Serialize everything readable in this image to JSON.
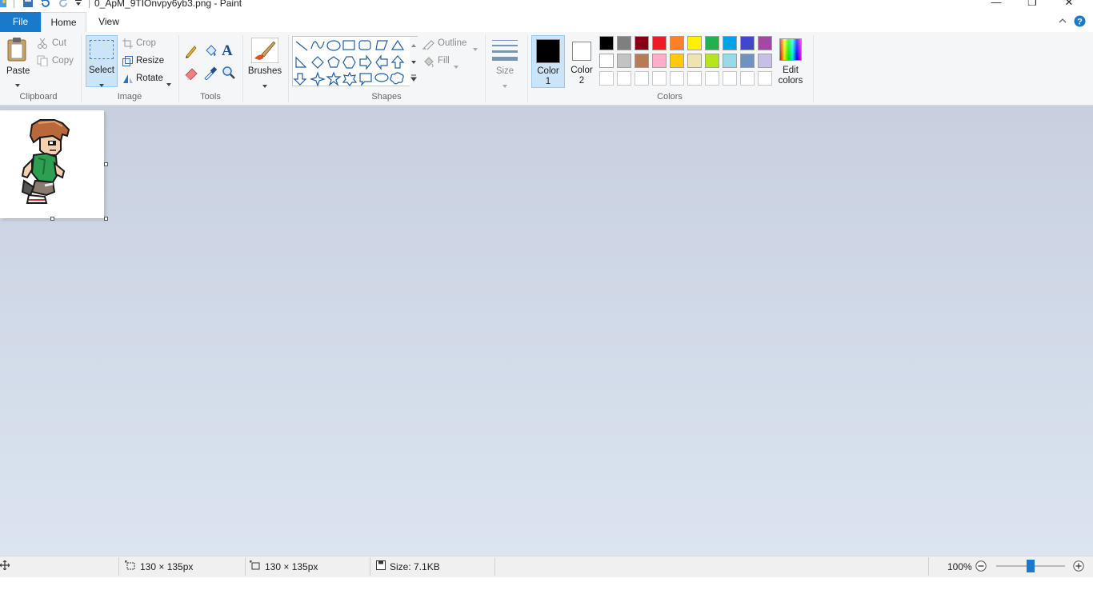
{
  "window": {
    "title": "0_ApM_9TIOnvpy6yb3.png - Paint",
    "minimize_glyph": "—",
    "maximize_glyph": "❐",
    "close_glyph": "✕"
  },
  "tabs": {
    "file": "File",
    "home": "Home",
    "view": "View"
  },
  "ribbon": {
    "clipboard": {
      "label": "Clipboard",
      "paste": "Paste",
      "cut": "Cut",
      "copy": "Copy"
    },
    "image": {
      "label": "Image",
      "select": "Select",
      "crop": "Crop",
      "resize": "Resize",
      "rotate": "Rotate"
    },
    "tools": {
      "label": "Tools",
      "text_glyph": "A"
    },
    "brushes": {
      "label": "Brushes"
    },
    "shapes": {
      "label": "Shapes",
      "outline": "Outline",
      "fill": "Fill"
    },
    "size": {
      "label": "Size"
    },
    "colors": {
      "label": "Colors",
      "color1": "Color",
      "color1_num": "1",
      "color2": "Color",
      "color2_num": "2",
      "edit_line1": "Edit",
      "edit_line2": "colors",
      "color1_value": "#000000",
      "color2_value": "#ffffff",
      "palette_row1": [
        "#000000",
        "#7f7f7f",
        "#880015",
        "#ed1c24",
        "#ff7f27",
        "#fff200",
        "#22b14c",
        "#00a2e8",
        "#3f48cc",
        "#a349a4"
      ],
      "palette_row2": [
        "#ffffff",
        "#c3c3c3",
        "#b97a57",
        "#ffaec9",
        "#ffc90e",
        "#efe4b0",
        "#b5e61d",
        "#99d9ea",
        "#7092be",
        "#c8bfe7"
      ]
    }
  },
  "status": {
    "selection_size": "130 × 135px",
    "image_size": "130 × 135px",
    "file_size": "Size: 7.1KB",
    "zoom": "100%",
    "zoom_level_percent": 100
  }
}
